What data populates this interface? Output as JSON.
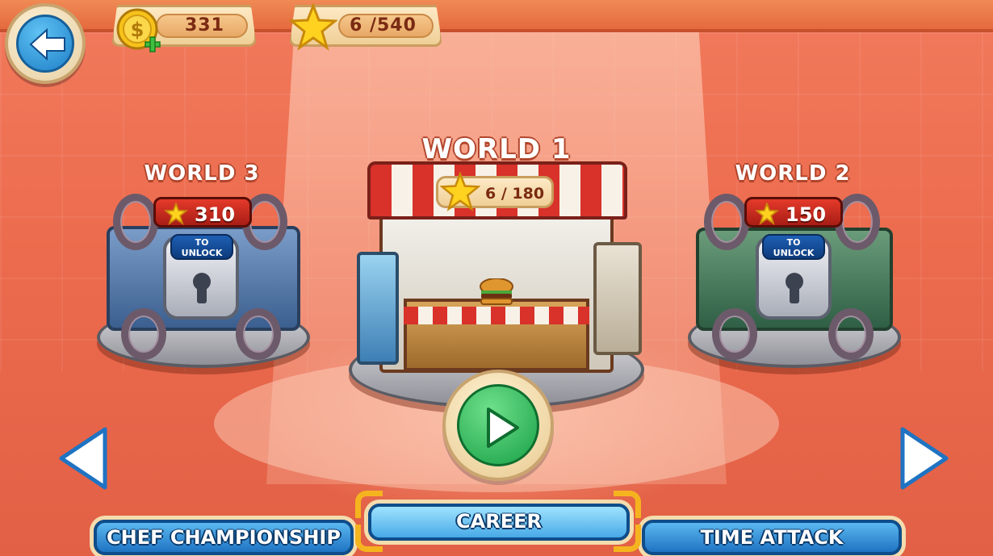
{
  "hud": {
    "coins": "331",
    "stars": "6  /540"
  },
  "worlds": [
    {
      "id": "world3",
      "title": "WORLD 3",
      "required_stars": "310",
      "locked_label": "TO\nUNLOCK"
    },
    {
      "id": "world1",
      "title": "WORLD 1",
      "stars": "6  / 180"
    },
    {
      "id": "world2",
      "title": "WORLD 2",
      "required_stars": "150",
      "locked_label": "TO\nUNLOCK"
    }
  ],
  "tabs": {
    "chef": "CHEF CHAMPIONSHIP",
    "career": "CAREER",
    "time": "TIME ATTACK"
  },
  "colors": {
    "background": "#ec6b4e",
    "tab_blue": "#1f73c2",
    "play_green": "#17a046",
    "badge_red": "#a81d14"
  },
  "icons": [
    "back-arrow-icon",
    "coin-plus-icon",
    "star-icon",
    "play-icon",
    "arrow-left-icon",
    "arrow-right-icon",
    "keyhole-lock-icon",
    "burger-icon"
  ]
}
